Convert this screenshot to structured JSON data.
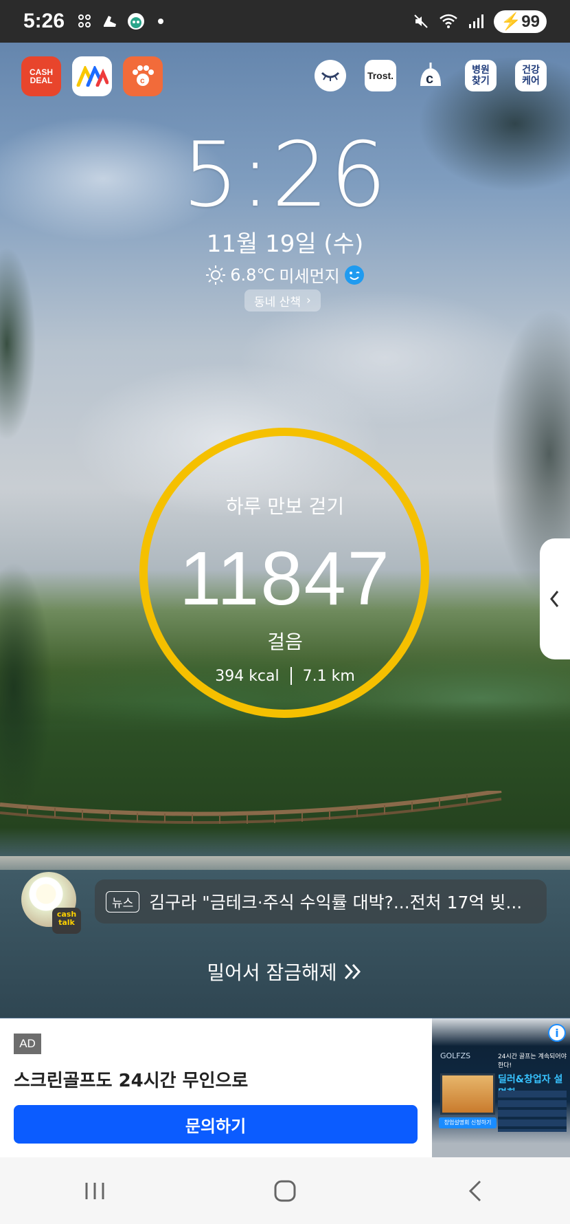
{
  "status_bar": {
    "time": "5:26",
    "battery": "99"
  },
  "shortcuts": {
    "left": [
      {
        "name": "cashdeal",
        "label": "CASH\nDEAL"
      },
      {
        "name": "m-app",
        "label": ""
      },
      {
        "name": "c-app",
        "label": ""
      }
    ],
    "right": [
      {
        "name": "eye-app",
        "label": ""
      },
      {
        "name": "trost",
        "label": "Trost."
      },
      {
        "name": "c-app2",
        "label": ""
      },
      {
        "name": "hospital",
        "label": "병원\n찾기"
      },
      {
        "name": "health",
        "label": "건강\n케어"
      }
    ]
  },
  "lock": {
    "time": "5:26",
    "date": "11월 19일 (수)",
    "temperature": "6.8℃",
    "dust_label": "미세먼지",
    "walk_chip": "동네 산책"
  },
  "steps": {
    "title": "하루 만보 걷기",
    "count": "11847",
    "unit": "걸음",
    "kcal": "394 kcal",
    "distance": "7.1 km",
    "ring_color": "#f5c000"
  },
  "news": {
    "tag": "뉴스",
    "headline": "김구라 \"금테크·주식 수익률 대박?...전처 17억 빚...",
    "badge": "cash talk"
  },
  "unlock": {
    "text": "밀어서 잠금해제"
  },
  "ad": {
    "badge": "AD",
    "title": "스크린골프도 24시간 무인으로",
    "button": "문의하기",
    "button_color": "#0b5cff",
    "image": {
      "brand": "GOLFZS",
      "headline": "24시간 골프는 계속되어야 한다!",
      "highlight": "딜러&창업자 설명회",
      "cta": "창업설명회 신청하기"
    }
  }
}
